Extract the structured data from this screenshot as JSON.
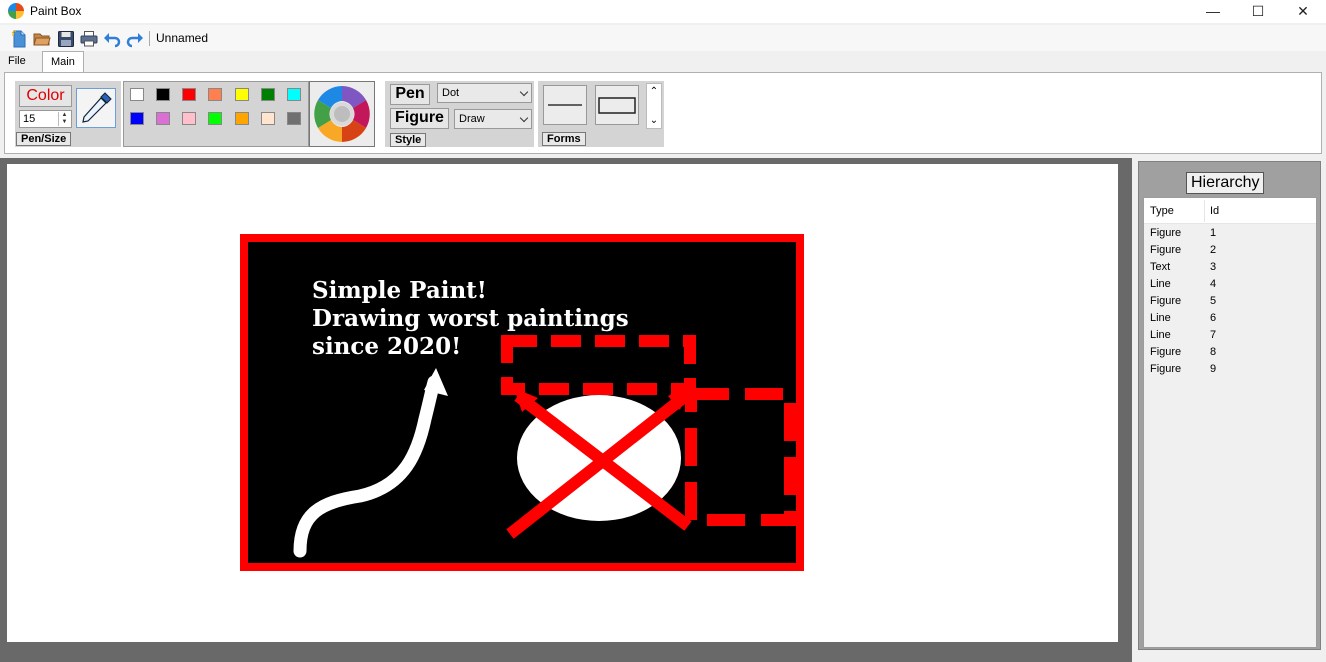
{
  "window": {
    "title": "Paint Box",
    "minimize_glyph": "—",
    "maximize_glyph": "☐",
    "close_glyph": "✕"
  },
  "toolbar": {
    "icons": [
      "new-file-icon",
      "open-folder-icon",
      "save-icon",
      "print-icon",
      "undo-icon",
      "redo-icon"
    ],
    "document_name": "Unnamed"
  },
  "tabs": [
    {
      "label": "File"
    },
    {
      "label": "Main",
      "selected": true
    }
  ],
  "ribbon": {
    "pen_size": {
      "color_label": "Color",
      "size_value": "15",
      "group_label": "Pen/Size"
    },
    "palette": [
      [
        "#ffffff",
        "#000000",
        "#ff0000",
        "#ff7f50",
        "#ffff00",
        "#008000",
        "#00ffff"
      ],
      [
        "#0000ff",
        "#da70d6",
        "#ffc0cb",
        "#00ff00",
        "#ffa500",
        "#ffe4d0",
        "#707070"
      ]
    ],
    "style": {
      "pen_label": "Pen",
      "pen_value": "Dot",
      "figure_label": "Figure",
      "figure_value": "Draw",
      "group_label": "Style"
    },
    "forms": {
      "group_label": "Forms",
      "items": [
        "line-form-icon",
        "rectangle-form-icon"
      ]
    }
  },
  "canvas": {
    "background_color": "#000000",
    "border_color": "#ff0000",
    "text_lines": [
      "Simple Paint!",
      "Drawing worst paintings",
      "since 2020!"
    ]
  },
  "hierarchy": {
    "title": "Hierarchy",
    "columns": [
      "Type",
      "Id"
    ],
    "rows": [
      {
        "type": "Figure",
        "id": "1"
      },
      {
        "type": "Figure",
        "id": "2"
      },
      {
        "type": "Text",
        "id": "3"
      },
      {
        "type": "Line",
        "id": "4"
      },
      {
        "type": "Figure",
        "id": "5"
      },
      {
        "type": "Line",
        "id": "6"
      },
      {
        "type": "Line",
        "id": "7"
      },
      {
        "type": "Figure",
        "id": "8"
      },
      {
        "type": "Figure",
        "id": "9"
      }
    ]
  }
}
